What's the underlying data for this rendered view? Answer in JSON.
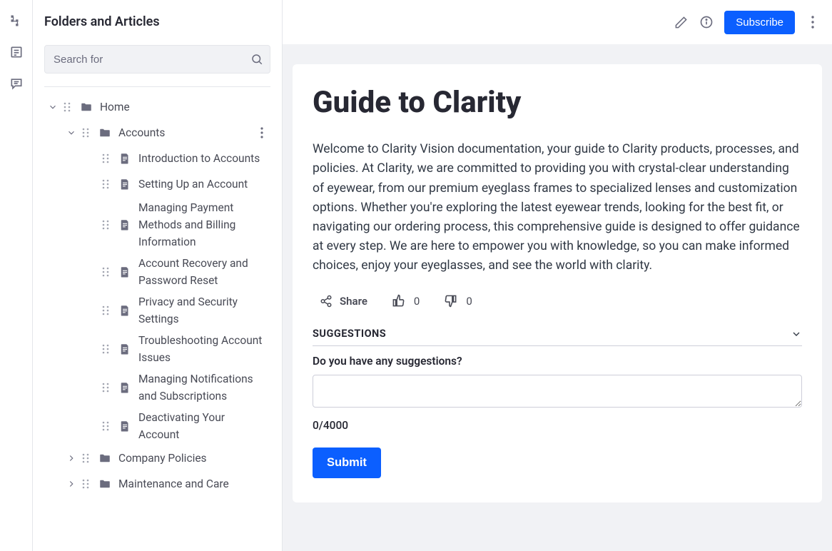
{
  "rail": {
    "items": [
      "tree",
      "page",
      "comment"
    ]
  },
  "sidebar": {
    "title": "Folders and Articles",
    "search_placeholder": "Search for"
  },
  "tree": {
    "home": "Home",
    "accounts": "Accounts",
    "articles": [
      "Introduction to Accounts",
      "Setting Up an Account",
      "Managing Payment Methods and Billing Information",
      "Account Recovery and Password Reset",
      "Privacy and Security Settings",
      "Troubleshooting Account Issues",
      "Managing Notifications and Subscriptions",
      "Deactivating Your Account"
    ],
    "company_policies": "Company Policies",
    "maintenance": "Maintenance and Care"
  },
  "toolbar": {
    "subscribe": "Subscribe"
  },
  "article": {
    "title": "Guide to Clarity",
    "body": "Welcome to Clarity Vision documentation, your guide to Clarity products, processes, and policies. At Clarity, we are committed to providing you with crystal-clear understanding of eyewear, from our premium eyeglass frames to specialized lenses and customization options. Whether you're exploring the latest eyewear trends, looking for the best fit, or navigating our ordering process, this comprehensive guide is designed to offer guidance at every step. We are here to empower you with knowledge, so you can make informed choices, enjoy your eyeglasses, and see the world with clarity.",
    "share": "Share",
    "upvotes": "0",
    "downvotes": "0"
  },
  "suggestions": {
    "header": "SUGGESTIONS",
    "prompt": "Do you have any suggestions?",
    "counter": "0/4000",
    "submit": "Submit"
  }
}
